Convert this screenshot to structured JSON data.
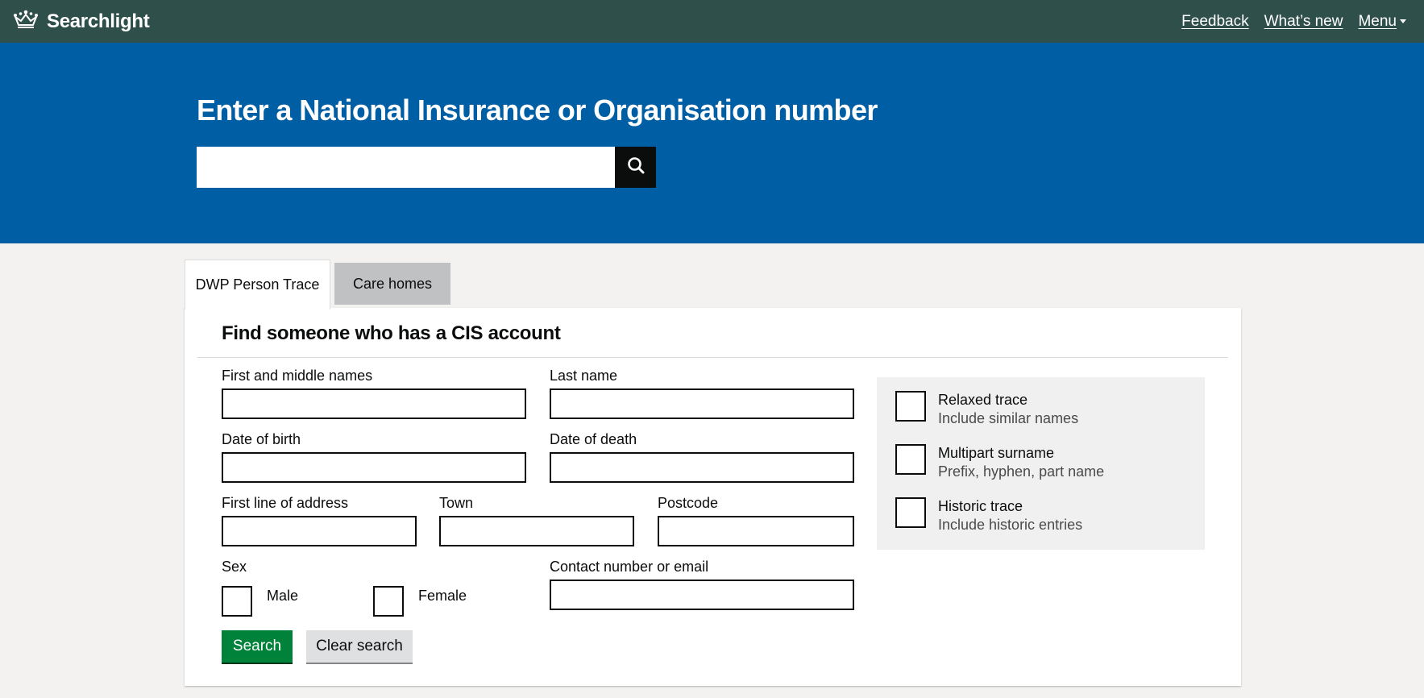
{
  "header": {
    "brand": "Searchlight",
    "nav": {
      "feedback": "Feedback",
      "whats_new": "What’s new",
      "menu": "Menu"
    },
    "background_color": "#2f4f4b"
  },
  "hero": {
    "title": "Enter a National Insurance or Organisation number",
    "search_value": "",
    "background_color": "#005ea5"
  },
  "tabs": [
    {
      "label": "DWP Person Trace",
      "active": true
    },
    {
      "label": "Care homes",
      "active": false
    }
  ],
  "form": {
    "title": "Find someone who has a CIS account",
    "fields": {
      "first_names": {
        "label": "First and middle names",
        "value": ""
      },
      "last_name": {
        "label": "Last name",
        "value": ""
      },
      "dob": {
        "label": "Date of birth",
        "value": ""
      },
      "dod": {
        "label": "Date of death",
        "value": ""
      },
      "address": {
        "label": "First line of address",
        "value": ""
      },
      "town": {
        "label": "Town",
        "value": ""
      },
      "postcode": {
        "label": "Postcode",
        "value": ""
      },
      "contact": {
        "label": "Contact number or email",
        "value": ""
      }
    },
    "sex": {
      "label": "Sex",
      "male": "Male",
      "female": "Female"
    },
    "options": [
      {
        "title": "Relaxed trace",
        "description": "Include similar names",
        "checked": false
      },
      {
        "title": "Multipart surname",
        "description": "Prefix, hyphen, part name",
        "checked": false
      },
      {
        "title": "Historic trace",
        "description": "Include historic entries",
        "checked": false
      }
    ],
    "buttons": {
      "search": "Search",
      "clear": "Clear search"
    },
    "search_button_color": "#00823b"
  }
}
